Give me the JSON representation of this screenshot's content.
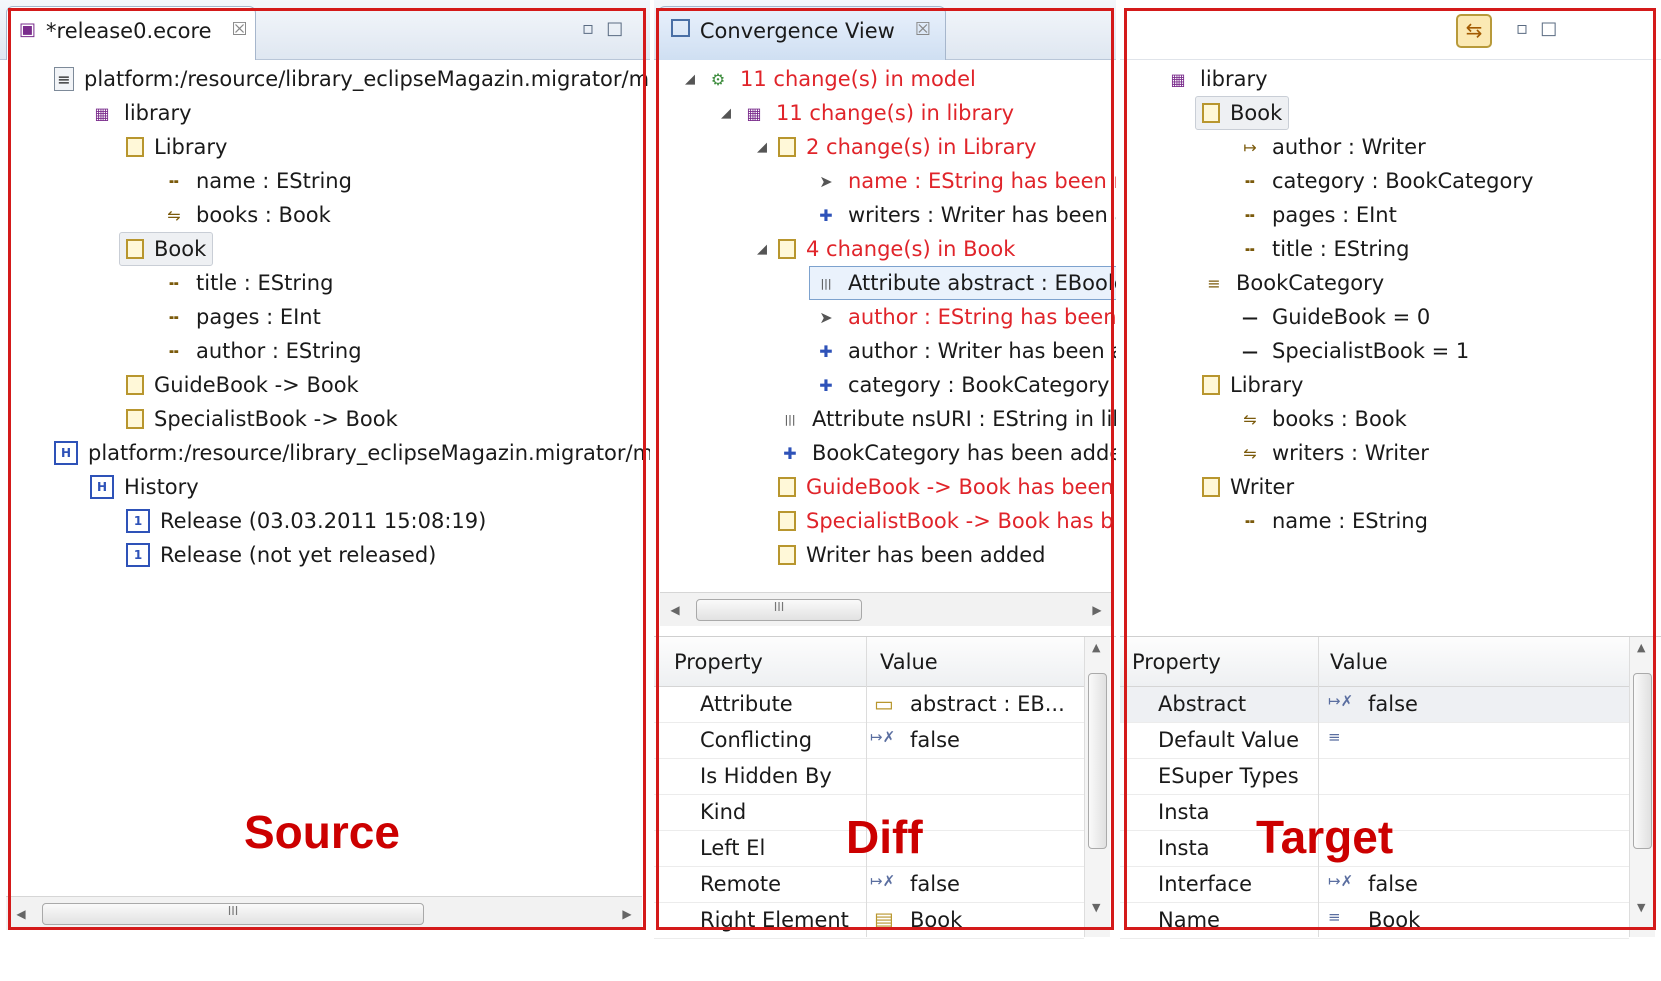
{
  "source": {
    "tab_title": "*release0.ecore",
    "tree": [
      {
        "label": "platform:/resource/library_eclipseMagazin.migrator/mi",
        "icon": "resource-file-icon"
      },
      {
        "label": "library",
        "icon": "package-icon"
      },
      {
        "label": "Library",
        "icon": "eclass-icon"
      },
      {
        "label": "name : EString",
        "icon": "eattribute-icon"
      },
      {
        "label": "books : Book",
        "icon": "ereference-many-icon"
      },
      {
        "label": "Book",
        "icon": "eclass-icon"
      },
      {
        "label": "title : EString",
        "icon": "eattribute-icon"
      },
      {
        "label": "pages : EInt",
        "icon": "eattribute-icon"
      },
      {
        "label": "author : EString",
        "icon": "eattribute-icon"
      },
      {
        "label": "GuideBook -> Book",
        "icon": "eclass-icon"
      },
      {
        "label": "SpecialistBook -> Book",
        "icon": "eclass-icon"
      },
      {
        "label": "platform:/resource/library_eclipseMagazin.migrator/mi",
        "icon": "history-file-icon"
      },
      {
        "label": "History",
        "icon": "history-icon"
      },
      {
        "label": "Release (03.03.2011 15:08:19)",
        "icon": "release-icon"
      },
      {
        "label": "Release (not yet released)",
        "icon": "release-icon"
      }
    ],
    "scroll_thumb": "III",
    "overlay_label": "Source"
  },
  "diff": {
    "tab_title": "Convergence View",
    "tree": [
      {
        "label": "11 change(s) in model",
        "icon": "model-changes-icon",
        "red": true
      },
      {
        "label": "11 change(s) in library",
        "icon": "package-changes-icon",
        "red": true
      },
      {
        "label": "2 change(s) in Library",
        "icon": "class-changes-icon",
        "red": true
      },
      {
        "label": "name : EString has been r",
        "icon": "attribute-removed-icon",
        "red": true
      },
      {
        "label": "writers : Writer has been a",
        "icon": "reference-added-icon",
        "red": false
      },
      {
        "label": "4 change(s) in Book",
        "icon": "class-changes-icon",
        "red": true
      },
      {
        "label": "Attribute abstract : EBoole",
        "icon": "attribute-changed-icon",
        "red": false
      },
      {
        "label": "author : EString has been",
        "icon": "attribute-removed-icon",
        "red": true
      },
      {
        "label": "author : Writer has been a",
        "icon": "reference-added-icon",
        "red": false
      },
      {
        "label": "category : BookCategory I",
        "icon": "attribute-added-icon",
        "red": false
      },
      {
        "label": "Attribute nsURI : EString in lib",
        "icon": "attribute-changed-icon",
        "red": false
      },
      {
        "label": "BookCategory has been adde",
        "icon": "enum-added-icon",
        "red": false
      },
      {
        "label": "GuideBook -> Book has been",
        "icon": "class-removed-icon",
        "red": true
      },
      {
        "label": "SpecialistBook -> Book has b",
        "icon": "class-removed-icon",
        "red": true
      },
      {
        "label": "Writer has been added",
        "icon": "class-added-icon",
        "red": false
      }
    ],
    "scroll_thumb": "III",
    "properties": {
      "header_property": "Property",
      "header_value": "Value",
      "rows": [
        {
          "property": "Attribute",
          "value": "abstract : EB...",
          "icon": "attribute-value-icon"
        },
        {
          "property": "Conflicting",
          "value": "false",
          "icon": "boolean-value-icon"
        },
        {
          "property": "Is Hidden By",
          "value": "",
          "icon": ""
        },
        {
          "property": "Kind",
          "value": "",
          "icon": ""
        },
        {
          "property": "Left El",
          "value": "",
          "icon": ""
        },
        {
          "property": "Remote",
          "value": "false",
          "icon": "boolean-value-icon"
        },
        {
          "property": "Right Element",
          "value": "Book",
          "icon": "class-value-icon"
        }
      ]
    },
    "overlay_label": "Diff"
  },
  "target": {
    "tree": [
      {
        "label": "library",
        "icon": "package-icon"
      },
      {
        "label": "Book",
        "icon": "eclass-icon"
      },
      {
        "label": "author : Writer",
        "icon": "ereference-icon"
      },
      {
        "label": "category : BookCategory",
        "icon": "eattribute-icon"
      },
      {
        "label": "pages : EInt",
        "icon": "eattribute-icon"
      },
      {
        "label": "title : EString",
        "icon": "eattribute-icon"
      },
      {
        "label": "BookCategory",
        "icon": "eenum-icon"
      },
      {
        "label": "GuideBook = 0",
        "icon": "eliteral-icon"
      },
      {
        "label": "SpecialistBook = 1",
        "icon": "eliteral-icon"
      },
      {
        "label": "Library",
        "icon": "eclass-icon"
      },
      {
        "label": "books : Book",
        "icon": "ereference-many-icon"
      },
      {
        "label": "writers : Writer",
        "icon": "ereference-many-icon"
      },
      {
        "label": "Writer",
        "icon": "eclass-icon"
      },
      {
        "label": "name : EString",
        "icon": "eattribute-icon"
      }
    ],
    "properties": {
      "header_property": "Property",
      "header_value": "Value",
      "rows": [
        {
          "property": "Abstract",
          "value": "false",
          "icon": "boolean-value-icon"
        },
        {
          "property": "Default Value",
          "value": "",
          "icon": "list-value-icon"
        },
        {
          "property": "ESuper Types",
          "value": "",
          "icon": ""
        },
        {
          "property": "Insta",
          "value": "",
          "icon": ""
        },
        {
          "property": "Insta",
          "value": "",
          "icon": ""
        },
        {
          "property": "Interface",
          "value": "false",
          "icon": "boolean-value-icon"
        },
        {
          "property": "Name",
          "value": "Book",
          "icon": "list-value-icon"
        }
      ]
    },
    "overlay_label": "Target"
  }
}
